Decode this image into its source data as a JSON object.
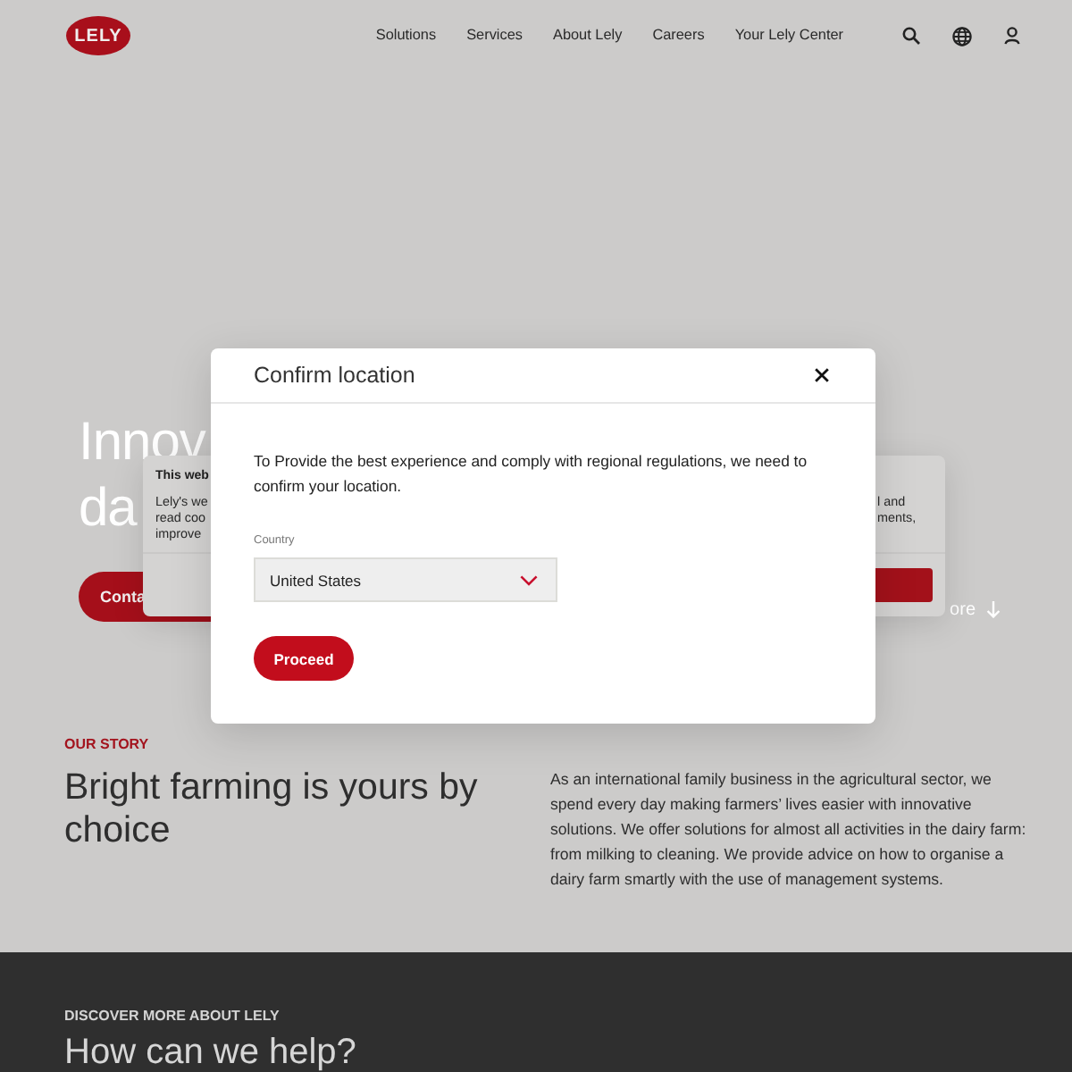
{
  "header": {
    "logo": "LELY",
    "nav": [
      "Solutions",
      "Services",
      "About Lely",
      "Careers",
      "Your Lely Center"
    ]
  },
  "hero": {
    "title_lines": [
      "Innov",
      "da"
    ],
    "contact_button": "Conta",
    "scroll_link": "ore"
  },
  "cookie_banner": {
    "title": "This web",
    "left_lines": [
      "Lely's we",
      "read coo",
      "improve"
    ],
    "right_lines": [
      "l and",
      "ments,"
    ]
  },
  "modal": {
    "title": "Confirm location",
    "message": "To Provide the best experience and comply with regional regulations, we need to confirm your location.",
    "country_field": {
      "label": "Country",
      "value": "United States"
    },
    "button": "Proceed"
  },
  "story": {
    "eyebrow": "OUR STORY",
    "heading": "Bright farming is yours by choice",
    "text": "As an international family business in the agricultural sector, we spend every day making farmers’ lives easier with innovative solutions. We offer solutions for almost all activities in the dairy farm: from milking to cleaning. We provide advice on how to organise a dairy farm smartly with the use of management systems."
  },
  "discover": {
    "eyebrow": "DISCOVER MORE ABOUT LELY",
    "heading": "How can we help?"
  }
}
